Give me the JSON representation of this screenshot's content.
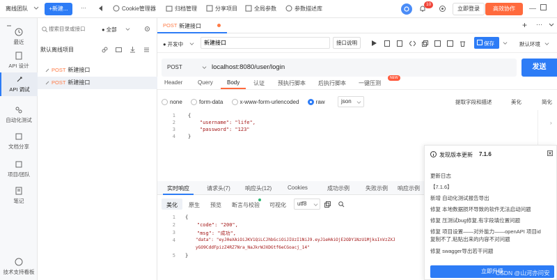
{
  "topbar": {
    "team": "离线团队",
    "new_button": "+新建...",
    "more": "···",
    "cookie_manager": "Cookie管理器",
    "archive_manager": "归档管理",
    "share_project": "分享项目",
    "global_params": "全局参数",
    "param_library": "参数描述库",
    "badge_count": "10",
    "login": "立即登录",
    "collab": "高效协作"
  },
  "leftnav": {
    "items": [
      {
        "label": "最近",
        "icon": "clock-icon"
      },
      {
        "label": "API 设计",
        "icon": "api-design-icon"
      },
      {
        "label": "API 调试",
        "icon": "api-debug-icon"
      },
      {
        "label": "自动化测试",
        "icon": "automation-icon"
      },
      {
        "label": "文档分享",
        "icon": "doc-share-icon"
      },
      {
        "label": "项目/团队",
        "icon": "team-icon"
      },
      {
        "label": "笔记",
        "icon": "note-icon"
      }
    ],
    "support": "技术支持看板"
  },
  "tree": {
    "search_placeholder": "搜索目录或接口",
    "filter": "● 全部",
    "project_label": "默认离线项目",
    "rows": [
      {
        "method": "POST",
        "name": "新建接口"
      },
      {
        "method": "POST",
        "name": "新建接口"
      }
    ]
  },
  "tabbar": {
    "tab_method": "POST",
    "tab_name": "新建接口"
  },
  "toolbar": {
    "status": "● 开发中",
    "name_value": "新建接口",
    "api_desc": "接口说明",
    "save": "保存",
    "env": "默认环境"
  },
  "request": {
    "method": "POST",
    "url": "localhost:8080/user/login",
    "send": "发送",
    "tabs": [
      "Header",
      "Query",
      "Body",
      "认证",
      "预执行脚本",
      "后执行脚本",
      "一键压测"
    ],
    "new_badge": "NEW",
    "body_types": [
      "none",
      "form-data",
      "x-www-form-urlencoded",
      "raw"
    ],
    "raw_format": "json",
    "extract_desc": "提取字段和描述",
    "beautify": "美化",
    "simplify": "简化",
    "code_lines": [
      {
        "n": "1",
        "text": "{"
      },
      {
        "n": "2",
        "text": "    \"username\": \"life\","
      },
      {
        "n": "3",
        "text": "    \"password\": \"123\""
      },
      {
        "n": "4",
        "text": "}"
      }
    ]
  },
  "response": {
    "tabs": [
      "实时响应",
      "请求头(7)",
      "响应头(12)",
      "Cookies",
      "成功示例",
      "失败示例",
      "响应示例"
    ],
    "sub_tabs": [
      "美化",
      "原生",
      "预览",
      "断言与校验",
      "可视化"
    ],
    "encoding": "utf8",
    "code_lines": [
      {
        "n": "1",
        "text": "{"
      },
      {
        "n": "2",
        "text": "    \"code\": \"200\","
      },
      {
        "n": "3",
        "text": "    \"msg\": \"成功\","
      },
      {
        "n": "4",
        "text": "    \"data\": \"eyJ0eXAiOiJKV1QiLCJhbGciOiJIUzI1NiJ9.eyJ1eHAiOjE2ODY1NzU1MjksInVzZXJ"
      },
      {
        "n": "",
        "text": "    yGO9CddFpizZ4RZ7Nra_NaJkrWJXDGtf6eCGoacj_14\""
      },
      {
        "n": "5",
        "text": "}"
      }
    ]
  },
  "update": {
    "title": "发现版本更新",
    "version": "7.1.6",
    "log_label": "更新日志",
    "version_tag": "【7.1.6】",
    "lines": [
      "新增 自动化测试报告导出",
      "修复 本地数据损坏导致的软件无法启动问题",
      "修复 压测试bug修复,有字段填位置问题",
      "修复 项目设置——对外能力——openAPI 项目id",
      "复制不了,粘贴出来的内容不对问题",
      "修复 swagger导出若干问题"
    ],
    "button": "立即升级",
    "watermark": "CSDN @山河亦问安"
  }
}
